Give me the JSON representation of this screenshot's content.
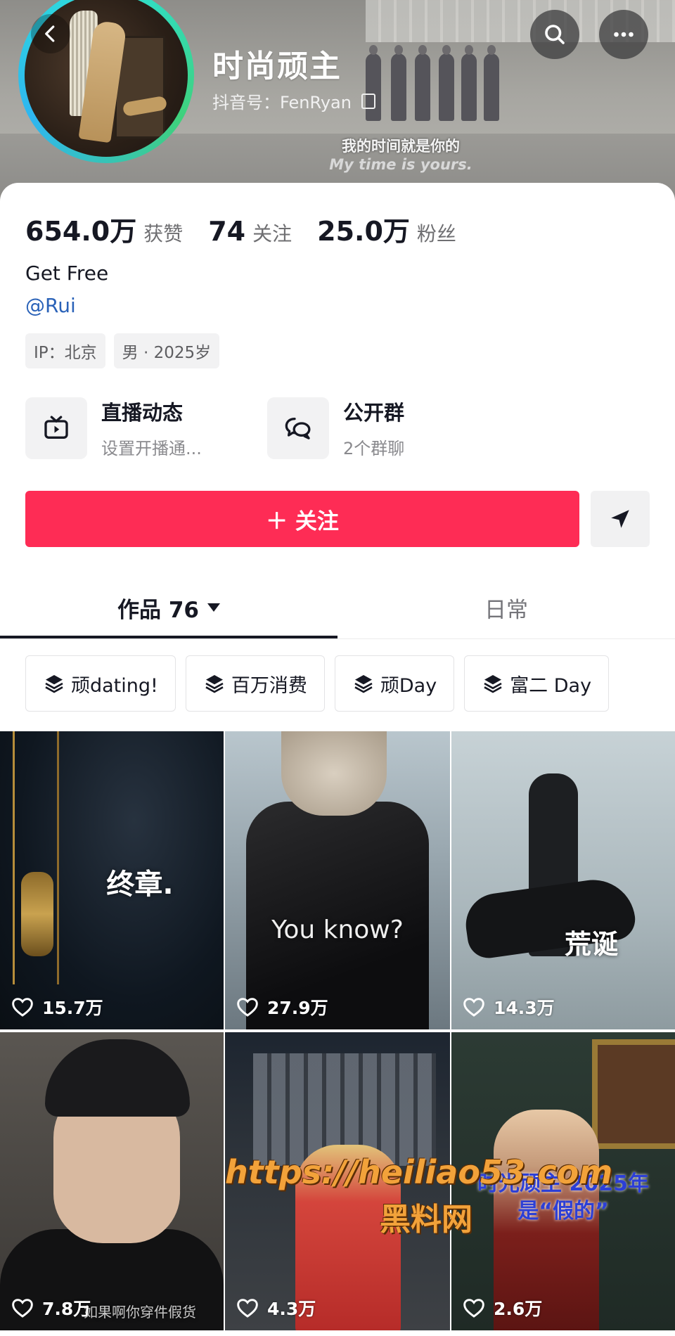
{
  "header": {
    "nickname": "时尚顽主",
    "douyin_id": "抖音号：FenRyan",
    "banner_caption_cn": "我的时间就是你的",
    "banner_caption_en": "My time is yours."
  },
  "stats": [
    {
      "value": "654.0万",
      "label": "获赞"
    },
    {
      "value": "74",
      "label": "关注"
    },
    {
      "value": "25.0万",
      "label": "粉丝"
    }
  ],
  "bio": "Get Free",
  "mention": "@Rui",
  "tags": [
    "IP：北京",
    "男 · 2025岁"
  ],
  "entries": [
    {
      "title": "直播动态",
      "subtitle": "设置开播通...",
      "icon": "tv-icon"
    },
    {
      "title": "公开群",
      "subtitle": "2个群聊",
      "icon": "group-chat-icon"
    }
  ],
  "follow_label": "＋ 关注",
  "tabs": {
    "works": "作品 76",
    "daily": "日常"
  },
  "collections": [
    "顽dating!",
    "百万消费",
    "顽Day",
    "富二 Day"
  ],
  "videos": [
    {
      "caption": "终章.",
      "likes": "15.7万"
    },
    {
      "caption": "You know?",
      "likes": "27.9万"
    },
    {
      "caption": "荒诞",
      "likes": "14.3万"
    },
    {
      "caption": "如果啊你穿件假货",
      "likes": "7.8万"
    },
    {
      "caption": "",
      "likes": "4.3万"
    },
    {
      "caption": "时光顽主 2025年是“假的”",
      "likes": "2.6万"
    }
  ],
  "watermark": {
    "url": "https://heiliao53.com",
    "name": "黑料网"
  },
  "colors": {
    "accent": "#fe2c55",
    "mention": "#2a62b8",
    "avatar_ring": "#2de0d7"
  }
}
